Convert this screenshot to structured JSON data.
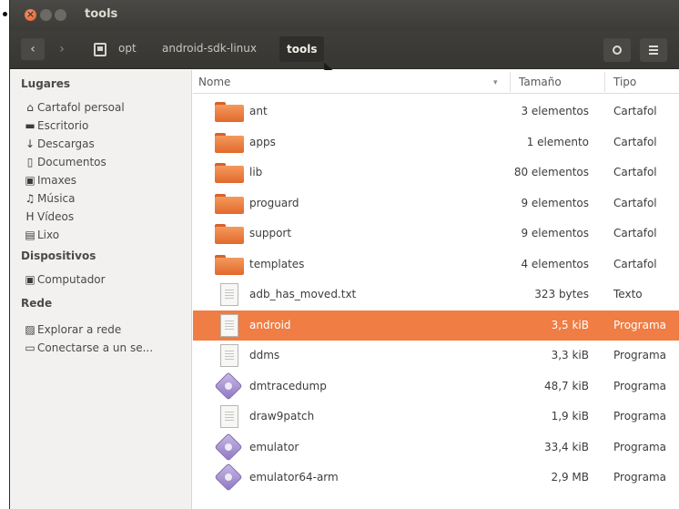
{
  "window": {
    "title": "tools"
  },
  "toolbar": {
    "breadcrumbs": [
      "opt",
      "android-sdk-linux",
      "tools"
    ]
  },
  "sidebar": {
    "sections": [
      {
        "heading": "Lugares",
        "items": [
          {
            "label": "Cartafol persoal",
            "icon": "home-icon"
          },
          {
            "label": "Escritorio",
            "icon": "desktop-icon"
          },
          {
            "label": "Descargas",
            "icon": "download-icon"
          },
          {
            "label": "Documentos",
            "icon": "document-icon"
          },
          {
            "label": "Imaxes",
            "icon": "camera-icon"
          },
          {
            "label": "Música",
            "icon": "music-icon"
          },
          {
            "label": "Vídeos",
            "icon": "film-icon"
          },
          {
            "label": "Lixo",
            "icon": "trash-icon"
          }
        ]
      },
      {
        "heading": "Dispositivos",
        "items": [
          {
            "label": "Computador",
            "icon": "computer-icon"
          }
        ]
      },
      {
        "heading": "Rede",
        "items": [
          {
            "label": "Explorar a rede",
            "icon": "network-icon"
          },
          {
            "label": "Conectarse a un se...",
            "icon": "server-icon"
          }
        ]
      }
    ]
  },
  "columns": {
    "name": "Nome",
    "size": "Tamaño",
    "type": "Tipo"
  },
  "files": [
    {
      "name": "ant",
      "size": "3 elementos",
      "type": "Cartafol",
      "icon": "folder-icon"
    },
    {
      "name": "apps",
      "size": "1 elemento",
      "type": "Cartafol",
      "icon": "folder-icon"
    },
    {
      "name": "lib",
      "size": "80 elementos",
      "type": "Cartafol",
      "icon": "folder-icon"
    },
    {
      "name": "proguard",
      "size": "9 elementos",
      "type": "Cartafol",
      "icon": "folder-icon"
    },
    {
      "name": "support",
      "size": "9 elementos",
      "type": "Cartafol",
      "icon": "folder-icon"
    },
    {
      "name": "templates",
      "size": "4 elementos",
      "type": "Cartafol",
      "icon": "folder-icon"
    },
    {
      "name": "adb_has_moved.txt",
      "size": "323 bytes",
      "type": "Texto",
      "icon": "text-file-icon"
    },
    {
      "name": "android",
      "size": "3,5 kiB",
      "type": "Programa",
      "icon": "script-file-icon",
      "selected": true
    },
    {
      "name": "ddms",
      "size": "3,3 kiB",
      "type": "Programa",
      "icon": "script-file-icon"
    },
    {
      "name": "dmtracedump",
      "size": "48,7 kiB",
      "type": "Programa",
      "icon": "executable-icon"
    },
    {
      "name": "draw9patch",
      "size": "1,9 kiB",
      "type": "Programa",
      "icon": "script-file-icon"
    },
    {
      "name": "emulator",
      "size": "33,4 kiB",
      "type": "Programa",
      "icon": "executable-icon"
    },
    {
      "name": "emulator64-arm",
      "size": "2,9 MB",
      "type": "Programa",
      "icon": "executable-icon"
    }
  ]
}
